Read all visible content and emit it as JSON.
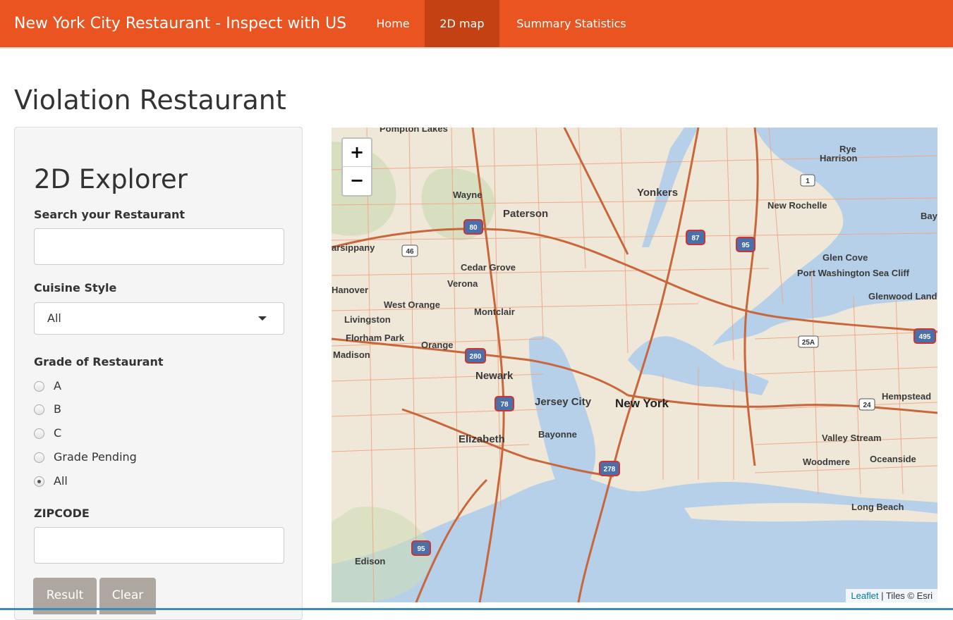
{
  "navbar": {
    "brand": "New York City Restaurant - Inspect with US",
    "items": [
      {
        "label": "Home",
        "active": false
      },
      {
        "label": "2D map",
        "active": true
      },
      {
        "label": "Summary Statistics",
        "active": false
      }
    ]
  },
  "page_title": "Violation Restaurant",
  "sidebar": {
    "title": "2D Explorer",
    "search_label": "Search your Restaurant",
    "search_value": "",
    "cuisine_label": "Cuisine Style",
    "cuisine_selected": "All",
    "grade_label": "Grade of Restaurant",
    "grades": [
      {
        "label": "A",
        "checked": false
      },
      {
        "label": "B",
        "checked": false
      },
      {
        "label": "C",
        "checked": false
      },
      {
        "label": "Grade Pending",
        "checked": false
      },
      {
        "label": "All",
        "checked": true
      }
    ],
    "zipcode_label": "ZIPCODE",
    "zipcode_value": "",
    "result_button": "Result",
    "clear_button": "Clear"
  },
  "map": {
    "zoom_in": "+",
    "zoom_out": "−",
    "attribution_link": "Leaflet",
    "attribution_text": " | Tiles © Esri",
    "place_labels": [
      "Pompton Lakes",
      "Rye",
      "Harrison",
      "Wayne",
      "Yonkers",
      "Paterson",
      "New Rochelle",
      "Bay",
      "arsippany",
      "Glen Cove",
      "Port Washington",
      "Sea Cliff",
      "Cedar Grove",
      "Verona",
      "Glenwood Landing",
      "Hanover",
      "West Orange",
      "Montclair",
      "Livingston",
      "Florham Park",
      "Orange",
      "Madison",
      "Newark",
      "Jersey City",
      "New York",
      "Hempstead",
      "Elizabeth",
      "Bayonne",
      "Valley Stream",
      "Woodmere",
      "Oceanside",
      "Long Beach",
      "Edison"
    ],
    "highway_shields": [
      "80",
      "46",
      "87",
      "95",
      "1",
      "25A",
      "495",
      "280",
      "78",
      "24",
      "278",
      "95"
    ]
  },
  "colors": {
    "navbar": "#e95420",
    "navbar_active": "#c34113",
    "button": "#aea79f",
    "water": "#b5d0e8",
    "land": "#efe8d8",
    "road": "#e07a4f"
  }
}
